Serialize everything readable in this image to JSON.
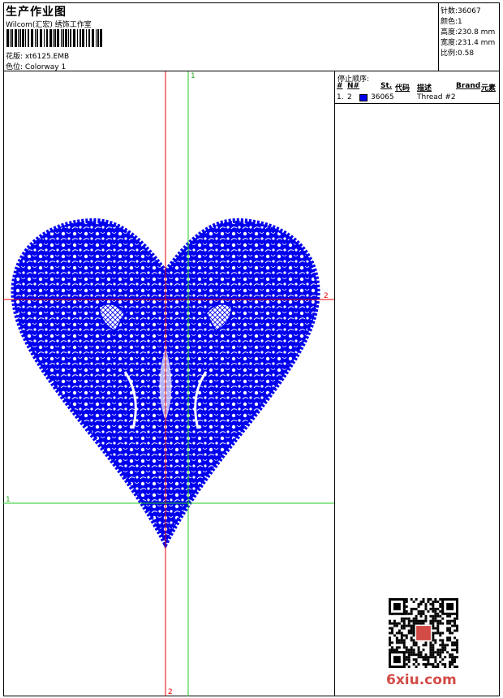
{
  "header": {
    "title": "生产作业图",
    "studio": "Wilcom(汇宏) 绣饰工作室",
    "design_label": "花版:",
    "design_value": "xt6125.EMB",
    "color_label": "色位:",
    "color_value": "Colorway 1"
  },
  "stats": [
    {
      "label": "针数:",
      "value": "36067"
    },
    {
      "label": "颜色:",
      "value": "1"
    },
    {
      "label": "高度:",
      "value": "230.8 mm"
    },
    {
      "label": "宽度:",
      "value": "231.4 mm"
    },
    {
      "label": "比例:",
      "value": "0.58"
    }
  ],
  "stop_sequence": {
    "title": "停止顺序:",
    "columns": {
      "num": "#",
      "needle": "N#",
      "stitches": "St.",
      "code": "代码",
      "desc": "描述",
      "brand": "Brand",
      "element": "元素"
    },
    "rows": [
      {
        "num": "1.",
        "needle": "2",
        "stitches": "36065",
        "code": "",
        "desc": "Thread #2",
        "brand": "",
        "element": "",
        "color": "#0000ee"
      }
    ]
  },
  "guides": {
    "red_vertical": "2",
    "red_horizontal": "2",
    "green_vertical": "1",
    "green_horizontal": "1"
  },
  "colors": {
    "thread": "#0000ee",
    "red_guide": "#ee0000",
    "green_guide": "#22cc22",
    "watermark": "#d24b46"
  },
  "watermark": "6xiu.com"
}
